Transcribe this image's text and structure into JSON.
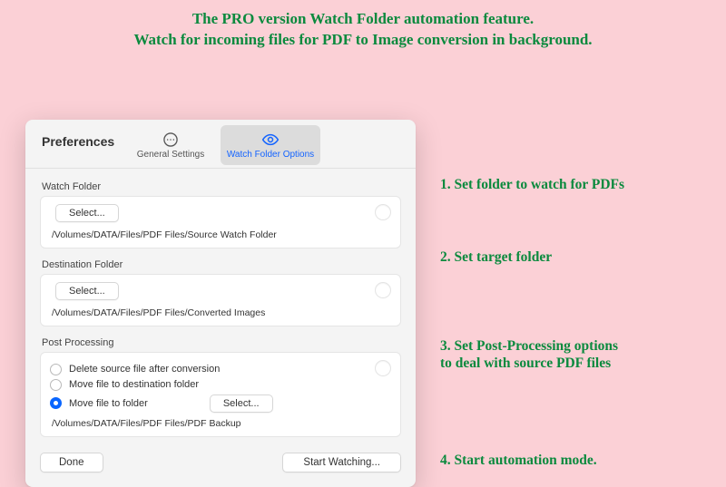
{
  "promo": {
    "line1": "The PRO version Watch Folder automation feature.",
    "line2": "Watch for incoming files for PDF to Image conversion in background."
  },
  "window": {
    "title": "Preferences",
    "tabs": [
      {
        "label": "General Settings",
        "selected": false,
        "icon": "ellipsis-circle"
      },
      {
        "label": "Watch Folder Options",
        "selected": true,
        "icon": "eye"
      }
    ],
    "watch_folder": {
      "section_label": "Watch Folder",
      "select_label": "Select...",
      "path": "/Volumes/DATA/Files/PDF Files/Source Watch Folder"
    },
    "destination_folder": {
      "section_label": "Destination Folder",
      "select_label": "Select...",
      "path": "/Volumes/DATA/Files/PDF Files/Converted Images"
    },
    "post_processing": {
      "section_label": "Post Processing",
      "options": [
        {
          "label": "Delete source file after conversion",
          "checked": false
        },
        {
          "label": "Move file to destination folder",
          "checked": false
        },
        {
          "label": "Move file to folder",
          "checked": true
        }
      ],
      "select_label": "Select...",
      "path": "/Volumes/DATA/Files/PDF Files/PDF Backup"
    },
    "footer": {
      "done_label": "Done",
      "start_label": "Start Watching..."
    }
  },
  "annotations": {
    "a1": "1. Set folder to watch for PDFs",
    "a2": "2. Set target folder",
    "a3": "3. Set Post-Processing options\n     to deal with source PDF files",
    "a4": "4. Start automation mode."
  }
}
